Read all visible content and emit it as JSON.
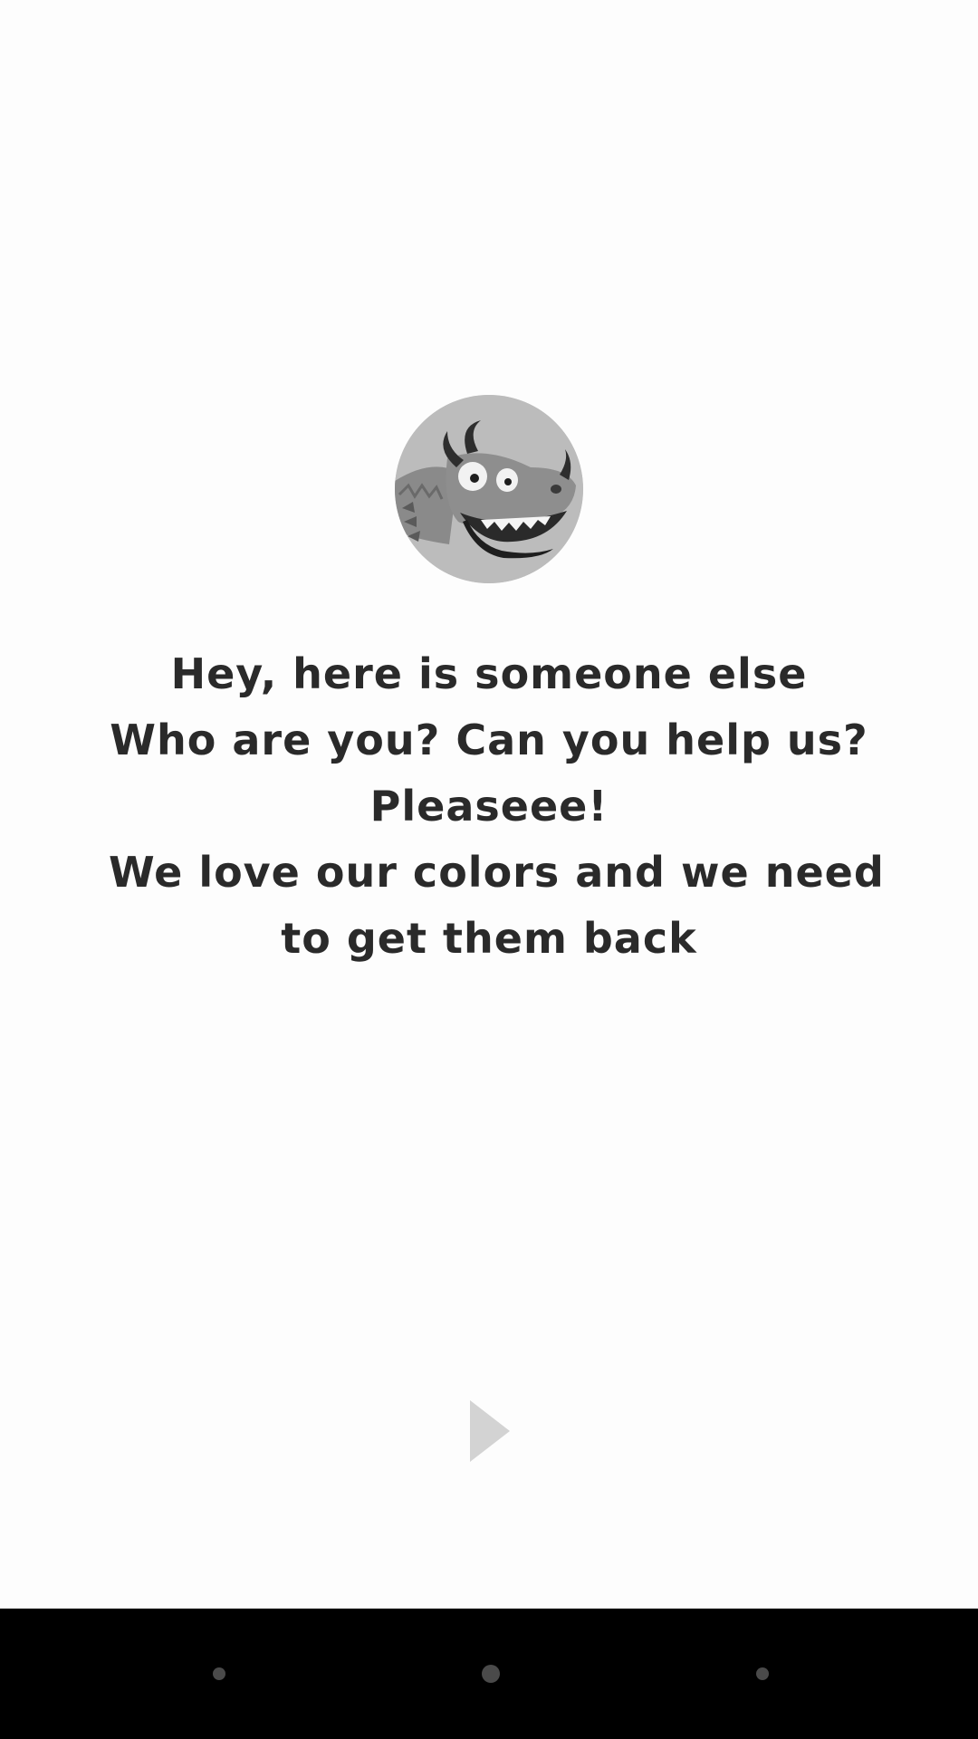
{
  "story": {
    "character": {
      "icon": "dragon-character-icon"
    },
    "lines": [
      "Hey, here is someone else",
      "Who are you? Can you help us?",
      "Pleaseee!",
      "We love our colors and we need",
      "to get them back"
    ],
    "next_icon": "play-icon"
  },
  "navigation_bar": {
    "back_icon": "back-dot-icon",
    "home_icon": "home-dot-icon",
    "recents_icon": "recents-dot-icon"
  },
  "colors": {
    "background": "#fdfdfd",
    "text": "#2a2a2a",
    "play_icon": "#d3d3d3",
    "nav_bar": "#000000"
  }
}
